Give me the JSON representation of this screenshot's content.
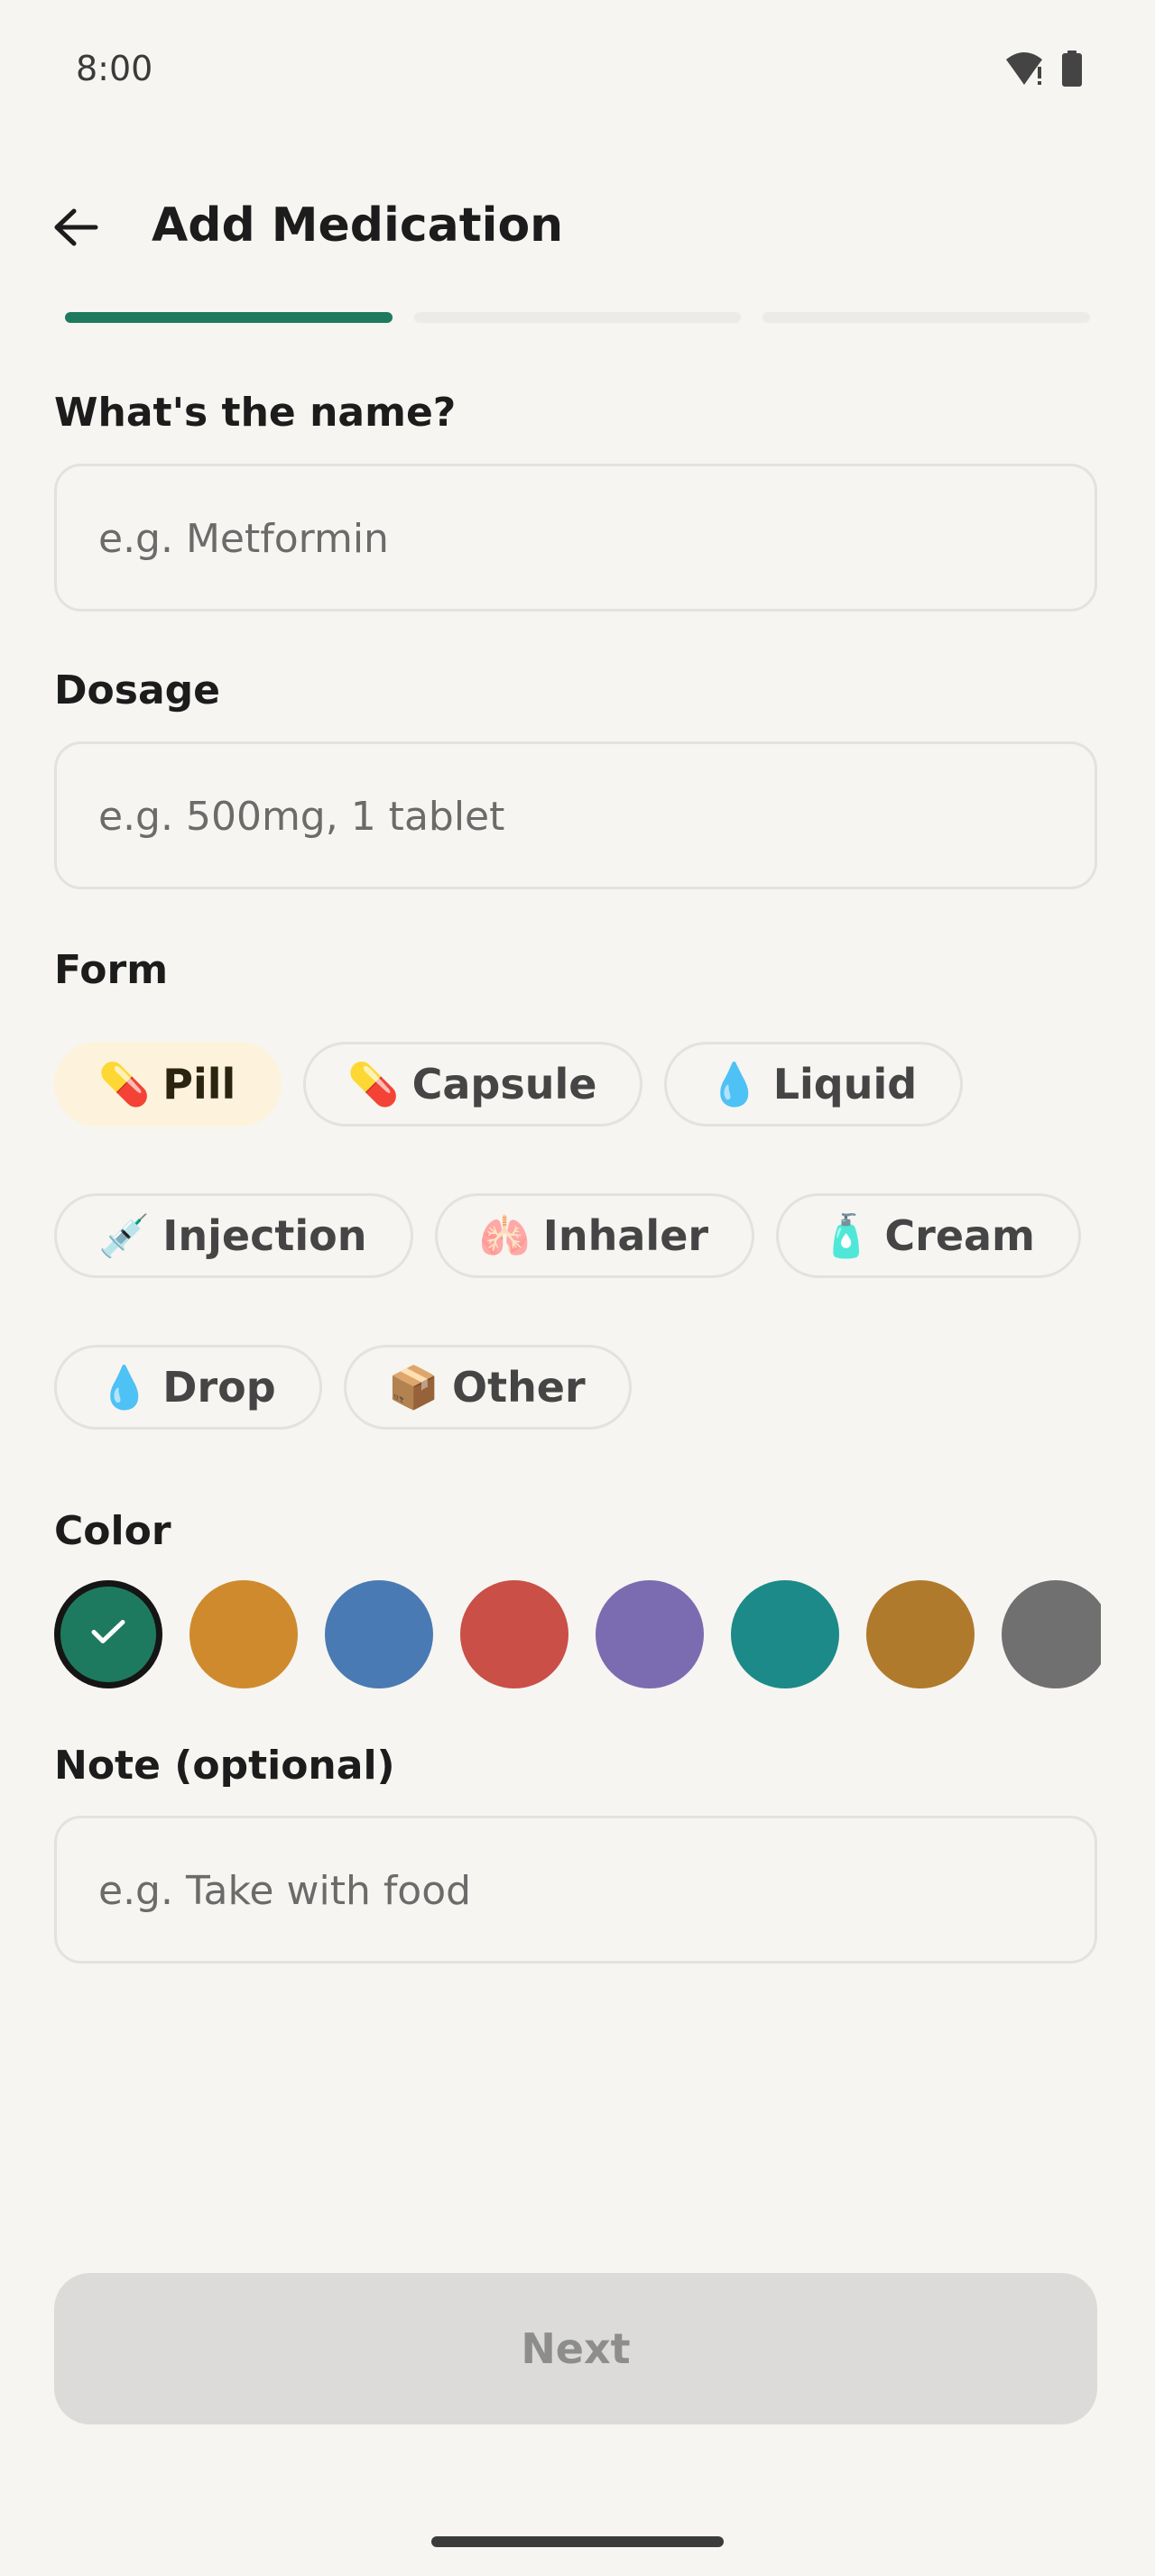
{
  "status_bar": {
    "time": "8:00"
  },
  "app_bar": {
    "title": "Add Medication",
    "back_icon": "arrow-back-icon"
  },
  "progress": {
    "steps_total": 3,
    "current_step": 1,
    "active_color": "#1e7a5e"
  },
  "name_field": {
    "label": "What's the name?",
    "placeholder": "e.g. Metformin",
    "value": ""
  },
  "dosage_field": {
    "label": "Dosage",
    "placeholder": "e.g. 500mg, 1 tablet",
    "value": ""
  },
  "form": {
    "label": "Form",
    "selected": "Pill",
    "options": [
      {
        "icon": "💊",
        "icon_name": "pill-icon",
        "label": "Pill"
      },
      {
        "icon": "💊",
        "icon_name": "capsule-icon",
        "label": "Capsule"
      },
      {
        "icon": "💧",
        "icon_name": "droplet-icon",
        "label": "Liquid"
      },
      {
        "icon": "💉",
        "icon_name": "syringe-icon",
        "label": "Injection"
      },
      {
        "icon": "🫁",
        "icon_name": "lungs-icon",
        "label": "Inhaler"
      },
      {
        "icon": "🧴",
        "icon_name": "lotion-bottle-icon",
        "label": "Cream"
      },
      {
        "icon": "💧",
        "icon_name": "droplet-icon",
        "label": "Drop"
      },
      {
        "icon": "📦",
        "icon_name": "package-icon",
        "label": "Other"
      }
    ]
  },
  "color": {
    "label": "Color",
    "selected_index": 0,
    "swatches": [
      "#1e7a5e",
      "#cf8a2e",
      "#4a7ab3",
      "#c94f47",
      "#7b6cb1",
      "#1c8a88",
      "#b07a2c",
      "#707070"
    ]
  },
  "note_field": {
    "label": "Note (optional)",
    "placeholder": "e.g. Take with food",
    "value": ""
  },
  "next_button": {
    "label": "Next",
    "enabled": false
  }
}
